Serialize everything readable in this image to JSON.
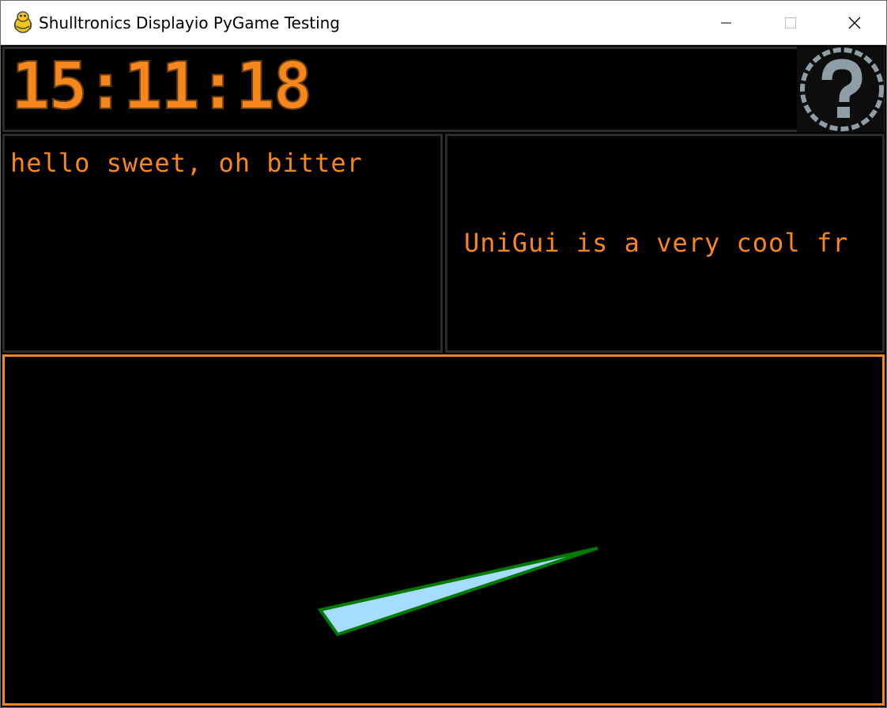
{
  "window": {
    "title": "Shulltronics Displayio PyGame Testing",
    "icon": "pygame-snake-icon",
    "controls": [
      "minimize-icon",
      "maximize-icon",
      "close-icon"
    ]
  },
  "clock": {
    "time": "15:11:18"
  },
  "help": {
    "icon": "question-mark-icon"
  },
  "left_label": {
    "text": "hello sweet, oh bitter"
  },
  "right_label": {
    "text": "UniGui is a very cool fr"
  },
  "graphic": {
    "shape": "needle-triangle",
    "fill_color": "#a6dcff",
    "outline_color": "#007a00"
  },
  "colors": {
    "accent": "#f6871f",
    "panel_border": "#2b2b2b",
    "background": "#000000",
    "help_icon": "#8e9ea6"
  }
}
